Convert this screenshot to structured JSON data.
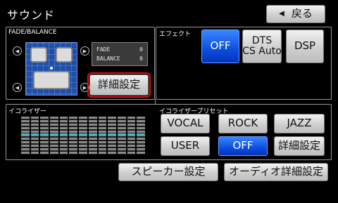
{
  "title": "サウンド",
  "back_button": {
    "icon": "left-triangle-icon",
    "label": "戻る"
  },
  "fade_balance": {
    "label": "FADE/BALANCE",
    "fade_label": "FADE",
    "fade_value": "0",
    "balance_label": "BALANCE",
    "balance_value": "0",
    "detail_button": "詳細設定"
  },
  "effect": {
    "label": "エフェクト",
    "buttons": [
      {
        "label": "OFF",
        "selected": true
      },
      {
        "label": "DTS\nCS Auto",
        "selected": false
      },
      {
        "label": "DSP",
        "selected": false
      }
    ]
  },
  "equalizer": {
    "label": "イコライザー",
    "band_count": 13
  },
  "eq_preset": {
    "label": "イコライザープリセット",
    "buttons": [
      {
        "label": "VOCAL",
        "selected": false
      },
      {
        "label": "ROCK",
        "selected": false
      },
      {
        "label": "JAZZ",
        "selected": false
      },
      {
        "label": "USER",
        "selected": false
      },
      {
        "label": "OFF",
        "selected": true
      },
      {
        "label": "詳細設定",
        "selected": false
      }
    ]
  },
  "bottom": {
    "speaker_button": "スピーカー設定",
    "audio_detail_button": "オーディオ詳細設定"
  },
  "colors": {
    "accent_blue": "#0a4fe0",
    "highlight_red": "#e01010",
    "eq_center": "#39c7d9"
  }
}
